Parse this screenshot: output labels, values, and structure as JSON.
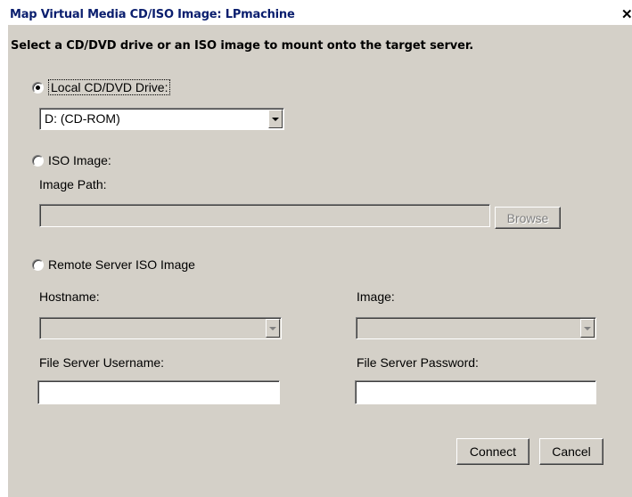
{
  "window": {
    "title": "Map Virtual Media CD/ISO Image: LPmachine",
    "close_glyph": "✕"
  },
  "instruction": "Select a CD/DVD drive or an ISO image to mount onto the target server.",
  "local_drive": {
    "label": "Local CD/DVD Drive:",
    "selected": true,
    "drive_value": "D: (CD-ROM)"
  },
  "iso_image": {
    "label": "ISO Image:",
    "selected": false,
    "path_label": "Image Path:",
    "path_value": "",
    "browse_label": "Browse"
  },
  "remote_iso": {
    "label": "Remote Server ISO Image",
    "selected": false,
    "hostname_label": "Hostname:",
    "hostname_value": "",
    "image_label": "Image:",
    "image_value": "",
    "username_label": "File Server Username:",
    "username_value": "",
    "password_label": "File Server Password:",
    "password_value": ""
  },
  "actions": {
    "connect_label": "Connect",
    "cancel_label": "Cancel"
  },
  "icons": [
    "close-icon",
    "chevron-down-icon"
  ],
  "colors": {
    "dialog_bg": "#d4d0c8",
    "title_text": "#0a1e6e"
  }
}
